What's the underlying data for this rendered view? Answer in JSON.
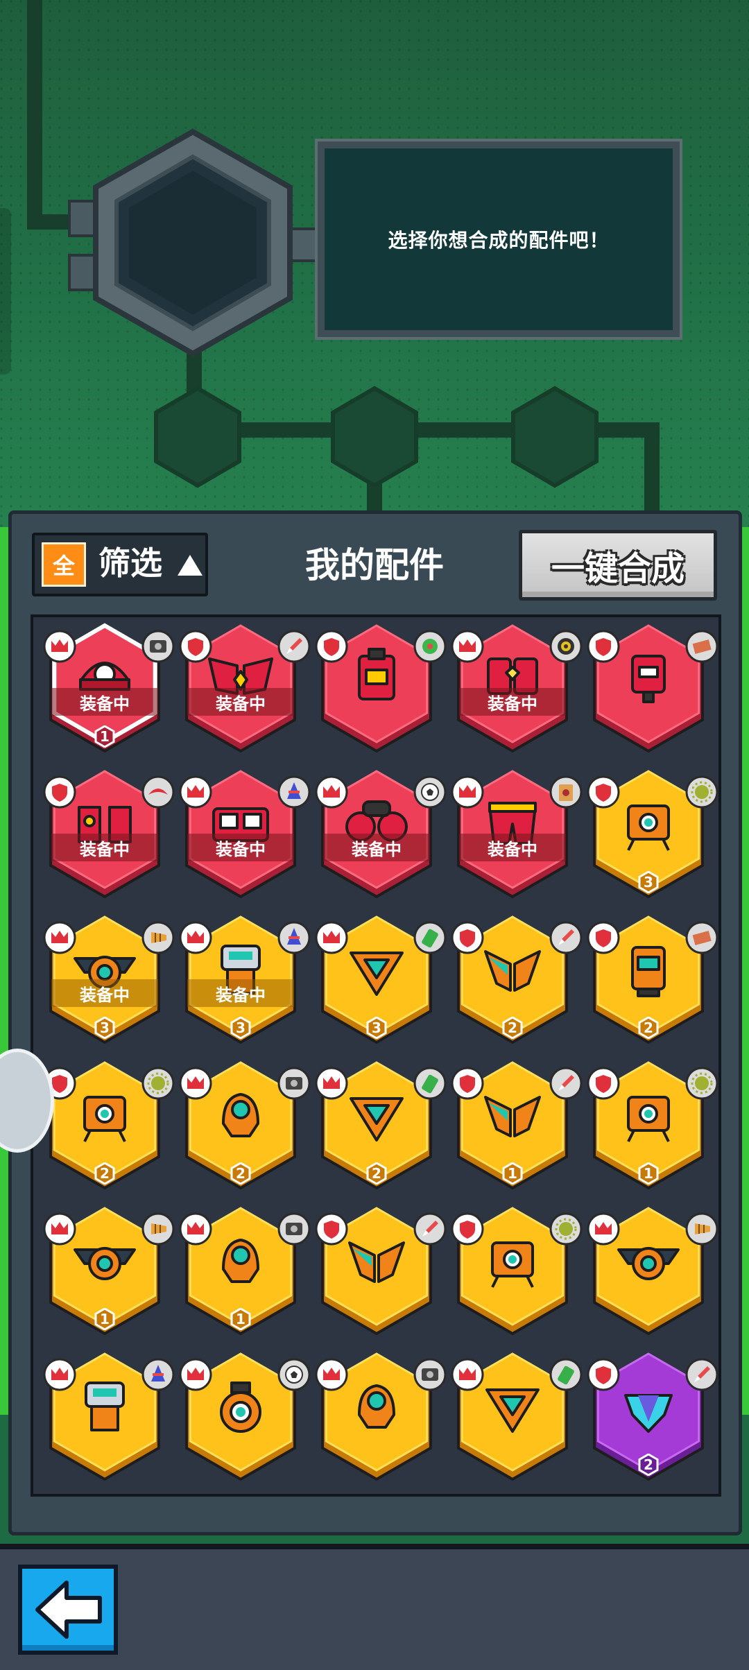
{
  "message": {
    "text": "选择你想合成的配件吧！"
  },
  "panel": {
    "title": "我的配件"
  },
  "filter": {
    "all_label": "全",
    "label": "筛选"
  },
  "merge_button": {
    "label": "一键合成"
  },
  "colors": {
    "red": "#ee3f58",
    "yellow": "#ffc21a",
    "purple": "#a43bd6",
    "shield_white": "#ffffff"
  },
  "items": [
    {
      "rarity": "red",
      "class": "crown",
      "ability": "camera",
      "shape": "dome-eye",
      "equipped": true,
      "equipped_text": "装备中",
      "level": "1",
      "selected": true
    },
    {
      "rarity": "red",
      "class": "shield",
      "ability": "rocket",
      "shape": "wings",
      "equipped": true,
      "equipped_text": "装备中",
      "level": ""
    },
    {
      "rarity": "red",
      "class": "shield",
      "ability": "cactus",
      "shape": "backpack",
      "equipped": false,
      "equipped_text": "",
      "level": ""
    },
    {
      "rarity": "red",
      "class": "crown",
      "ability": "target",
      "shape": "box-pair",
      "equipped": true,
      "equipped_text": "装备中",
      "level": ""
    },
    {
      "rarity": "red",
      "class": "shield",
      "ability": "brick",
      "shape": "robot",
      "equipped": false,
      "equipped_text": "",
      "level": ""
    },
    {
      "rarity": "red",
      "class": "shield",
      "ability": "boomerang",
      "shape": "speakers",
      "equipped": true,
      "equipped_text": "装备中",
      "level": ""
    },
    {
      "rarity": "red",
      "class": "crown",
      "ability": "spinner",
      "shape": "double-box",
      "equipped": true,
      "equipped_text": "装备中",
      "level": ""
    },
    {
      "rarity": "red",
      "class": "crown",
      "ability": "football",
      "shape": "goggles",
      "equipped": true,
      "equipped_text": "装备中",
      "level": ""
    },
    {
      "rarity": "red",
      "class": "crown",
      "ability": "card",
      "shape": "pants",
      "equipped": true,
      "equipped_text": "装备中",
      "level": ""
    },
    {
      "rarity": "yellow",
      "class": "shield",
      "ability": "virus",
      "shape": "walker",
      "equipped": false,
      "equipped_text": "",
      "level": "3"
    },
    {
      "rarity": "yellow",
      "class": "crown",
      "ability": "drill",
      "shape": "lamp",
      "equipped": true,
      "equipped_text": "装备中",
      "level": "3"
    },
    {
      "rarity": "yellow",
      "class": "crown",
      "ability": "spinner",
      "shape": "cyan-robot",
      "equipped": true,
      "equipped_text": "装备中",
      "level": "3"
    },
    {
      "rarity": "yellow",
      "class": "crown",
      "ability": "battery",
      "shape": "triangle",
      "equipped": false,
      "equipped_text": "",
      "level": "3"
    },
    {
      "rarity": "yellow",
      "class": "shield",
      "ability": "rocket",
      "shape": "wings-cyan",
      "equipped": false,
      "equipped_text": "",
      "level": "2"
    },
    {
      "rarity": "yellow",
      "class": "shield",
      "ability": "brick",
      "shape": "tower",
      "equipped": false,
      "equipped_text": "",
      "level": "2"
    },
    {
      "rarity": "yellow",
      "class": "shield",
      "ability": "virus",
      "shape": "walker",
      "equipped": false,
      "equipped_text": "",
      "level": "2"
    },
    {
      "rarity": "yellow",
      "class": "crown",
      "ability": "camera",
      "shape": "pod",
      "equipped": false,
      "equipped_text": "",
      "level": "2"
    },
    {
      "rarity": "yellow",
      "class": "crown",
      "ability": "battery",
      "shape": "triangle",
      "equipped": false,
      "equipped_text": "",
      "level": "2"
    },
    {
      "rarity": "yellow",
      "class": "shield",
      "ability": "rocket",
      "shape": "wings-cyan",
      "equipped": false,
      "equipped_text": "",
      "level": "1"
    },
    {
      "rarity": "yellow",
      "class": "shield",
      "ability": "virus",
      "shape": "walker",
      "equipped": false,
      "equipped_text": "",
      "level": "1"
    },
    {
      "rarity": "yellow",
      "class": "crown",
      "ability": "drill",
      "shape": "lamp",
      "equipped": false,
      "equipped_text": "",
      "level": "1"
    },
    {
      "rarity": "yellow",
      "class": "crown",
      "ability": "camera",
      "shape": "pod",
      "equipped": false,
      "equipped_text": "",
      "level": "1"
    },
    {
      "rarity": "yellow",
      "class": "shield",
      "ability": "rocket",
      "shape": "wings-cyan",
      "equipped": false,
      "equipped_text": "",
      "level": ""
    },
    {
      "rarity": "yellow",
      "class": "shield",
      "ability": "virus",
      "shape": "walker",
      "equipped": false,
      "equipped_text": "",
      "level": ""
    },
    {
      "rarity": "yellow",
      "class": "crown",
      "ability": "drill",
      "shape": "lamp",
      "equipped": false,
      "equipped_text": "",
      "level": ""
    },
    {
      "rarity": "yellow",
      "class": "crown",
      "ability": "spinner",
      "shape": "cyan-robot",
      "equipped": false,
      "equipped_text": "",
      "level": ""
    },
    {
      "rarity": "yellow",
      "class": "crown",
      "ability": "football",
      "shape": "ring",
      "equipped": false,
      "equipped_text": "",
      "level": ""
    },
    {
      "rarity": "yellow",
      "class": "crown",
      "ability": "camera",
      "shape": "pod",
      "equipped": false,
      "equipped_text": "",
      "level": ""
    },
    {
      "rarity": "yellow",
      "class": "crown",
      "ability": "battery",
      "shape": "triangle",
      "equipped": false,
      "equipped_text": "",
      "level": ""
    },
    {
      "rarity": "purple",
      "class": "shield",
      "ability": "rocket",
      "shape": "gem",
      "equipped": false,
      "equipped_text": "",
      "level": "2"
    }
  ]
}
